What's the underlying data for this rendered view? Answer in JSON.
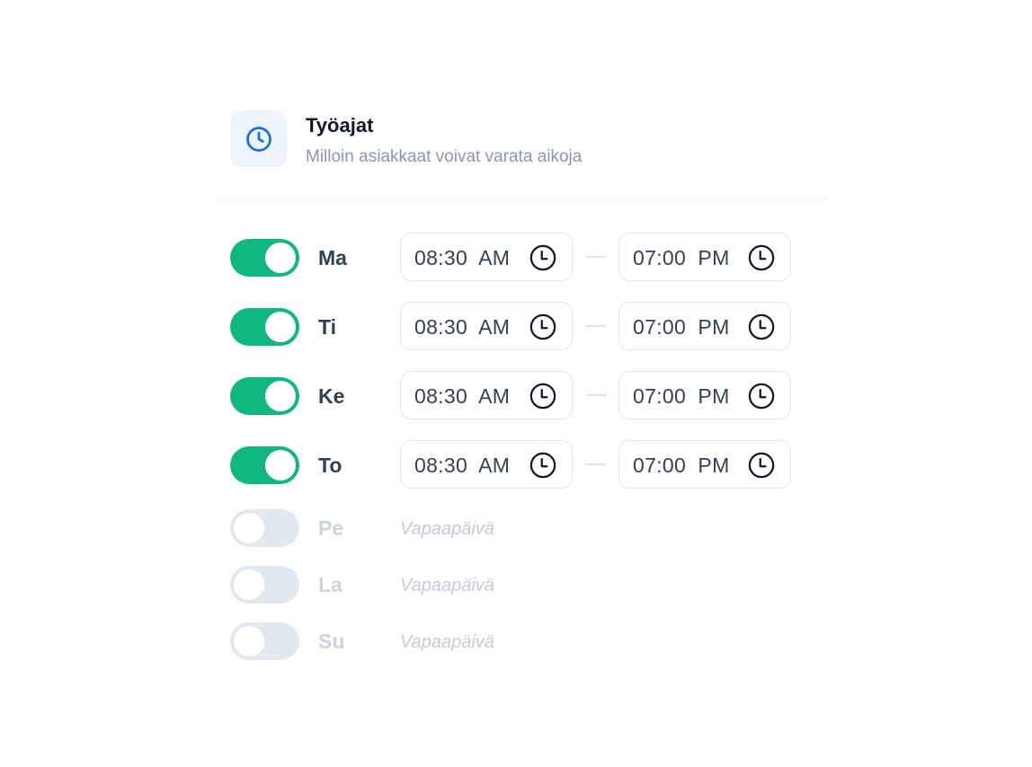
{
  "header": {
    "title": "Työajat",
    "subtitle": "Milloin asiakkaat voivat varata aikoja",
    "icon": "clock-icon"
  },
  "colors": {
    "accent": "#10b77f",
    "icon_blue": "#1d6fdc",
    "toggle_off": "#e2e8f0"
  },
  "days": [
    {
      "label": "Ma",
      "enabled": true,
      "start": "08:30  AM",
      "end": "07:00  PM"
    },
    {
      "label": "Ti",
      "enabled": true,
      "start": "08:30  AM",
      "end": "07:00  PM"
    },
    {
      "label": "Ke",
      "enabled": true,
      "start": "08:30  AM",
      "end": "07:00  PM"
    },
    {
      "label": "To",
      "enabled": true,
      "start": "08:30  AM",
      "end": "07:00  PM"
    },
    {
      "label": "Pe",
      "enabled": false,
      "off_text": "Vapaapäivä"
    },
    {
      "label": "La",
      "enabled": false,
      "off_text": "Vapaapäivä"
    },
    {
      "label": "Su",
      "enabled": false,
      "off_text": "Vapaapäivä"
    }
  ]
}
